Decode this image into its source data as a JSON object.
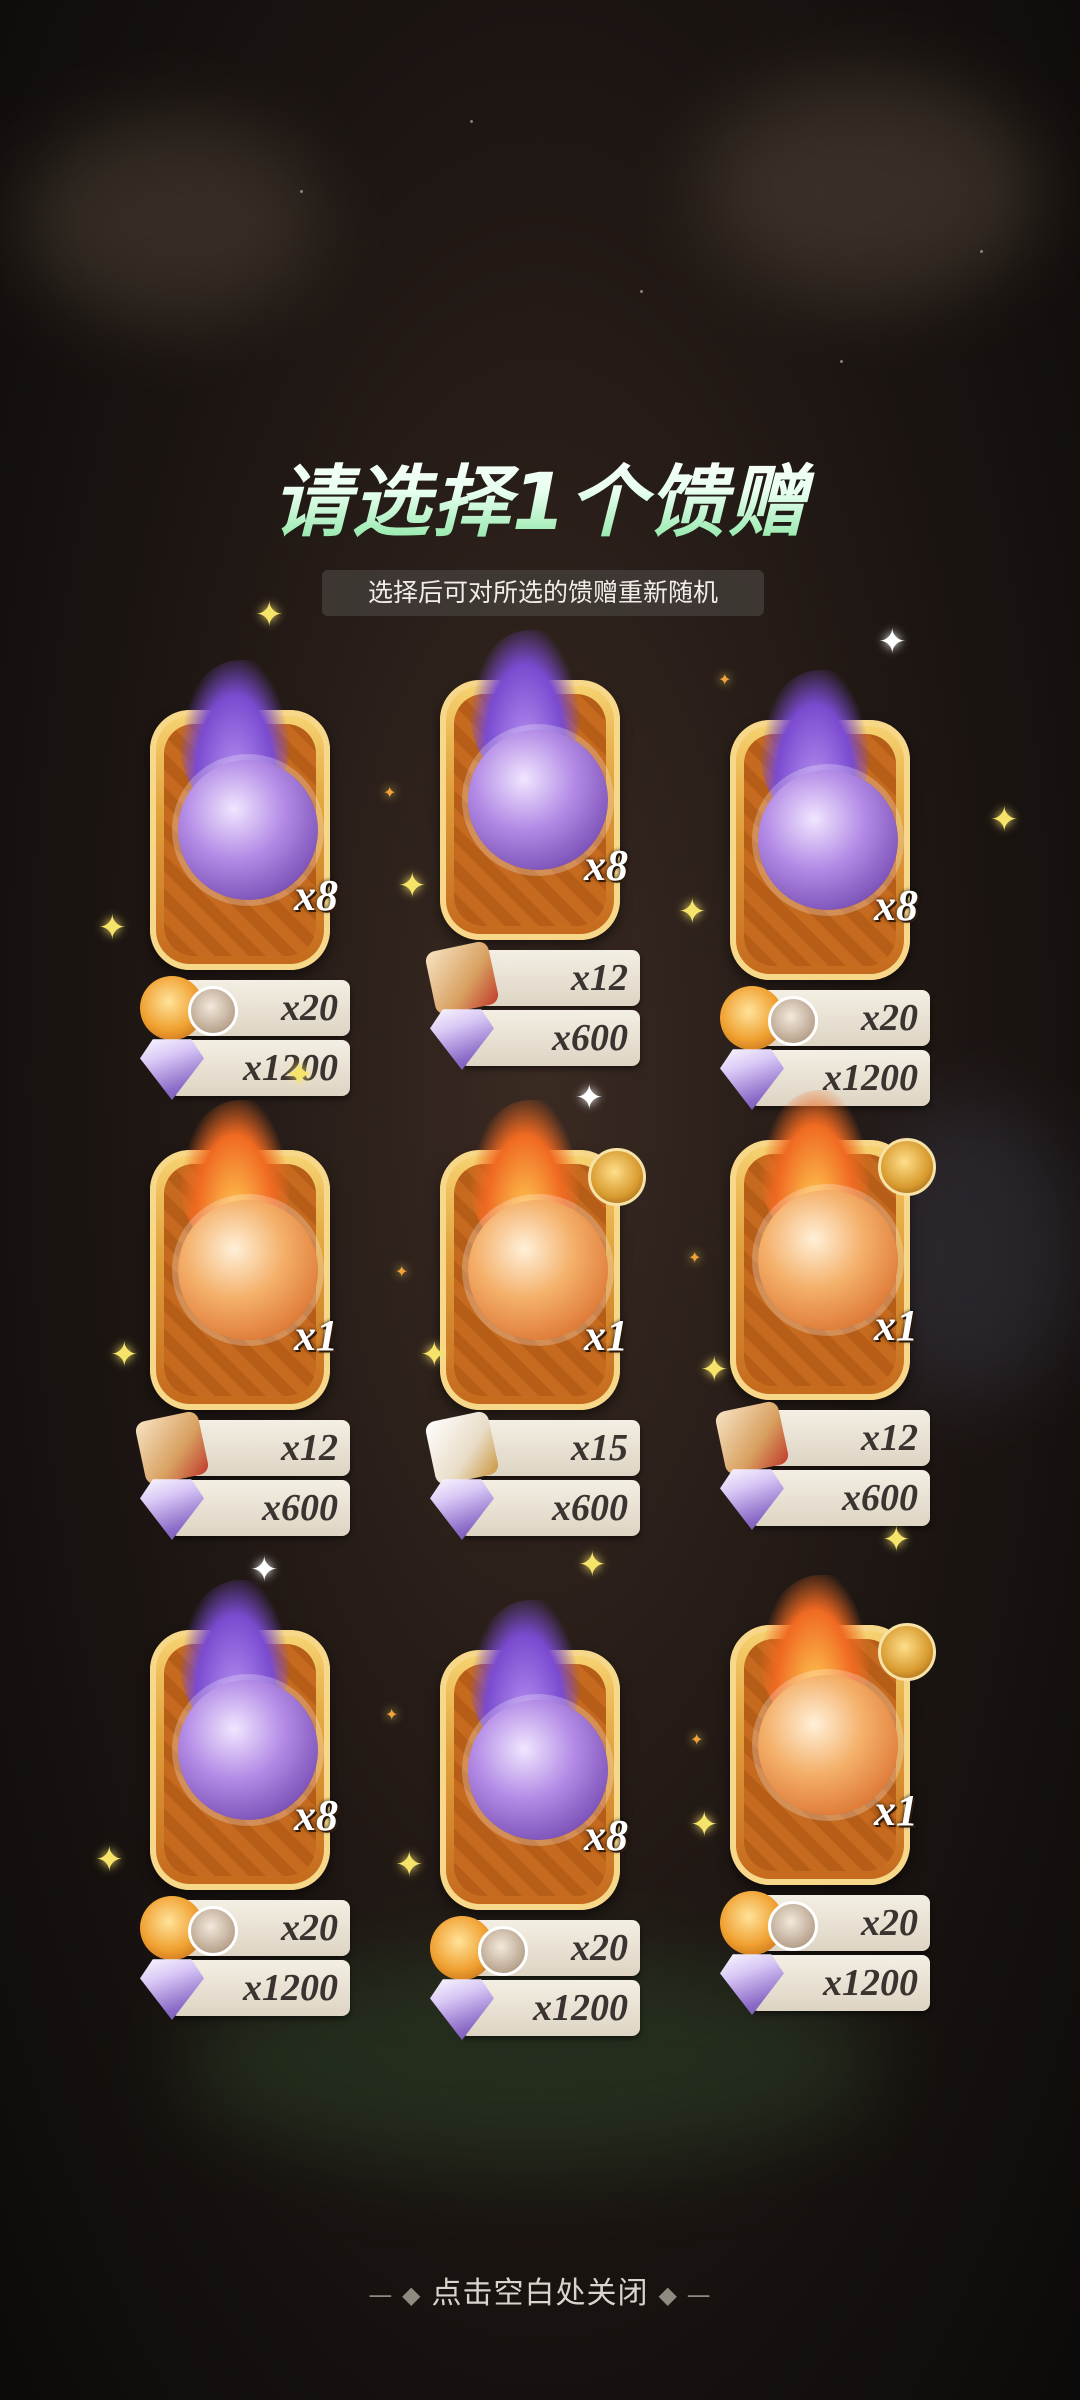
{
  "dialog": {
    "title": "请选择1个馈赠",
    "subtitle": "选择后可对所选的馈赠重新随机",
    "close_hint": "点击空白处关闭"
  },
  "cards": [
    {
      "flame": "purple",
      "character_multiplier": "x8",
      "reward1_icon": "gold-token-icon",
      "reward1_qty": "x20",
      "reward2_icon": "diamond-gem-icon",
      "reward2_qty": "x1200",
      "badge": false
    },
    {
      "flame": "purple",
      "character_multiplier": "x8",
      "reward1_icon": "red-envelope-icon",
      "reward1_qty": "x12",
      "reward2_icon": "diamond-gem-icon",
      "reward2_qty": "x600",
      "badge": false
    },
    {
      "flame": "purple",
      "character_multiplier": "x8",
      "reward1_icon": "gold-token-icon",
      "reward1_qty": "x20",
      "reward2_icon": "diamond-gem-icon",
      "reward2_qty": "x1200",
      "badge": false
    },
    {
      "flame": "fire",
      "character_multiplier": "x1",
      "reward1_icon": "red-envelope-icon",
      "reward1_qty": "x12",
      "reward2_icon": "diamond-gem-icon",
      "reward2_qty": "x600",
      "badge": false
    },
    {
      "flame": "fire",
      "character_multiplier": "x1",
      "reward1_icon": "white-envelope-icon",
      "reward1_qty": "x15",
      "reward2_icon": "diamond-gem-icon",
      "reward2_qty": "x600",
      "badge": true
    },
    {
      "flame": "fire",
      "character_multiplier": "x1",
      "reward1_icon": "red-envelope-icon",
      "reward1_qty": "x12",
      "reward2_icon": "diamond-gem-icon",
      "reward2_qty": "x600",
      "badge": true
    },
    {
      "flame": "purple",
      "character_multiplier": "x8",
      "reward1_icon": "gold-token-icon",
      "reward1_qty": "x20",
      "reward2_icon": "diamond-gem-icon",
      "reward2_qty": "x1200",
      "badge": false
    },
    {
      "flame": "purple",
      "character_multiplier": "x8",
      "reward1_icon": "gold-token-icon",
      "reward1_qty": "x20",
      "reward2_icon": "diamond-gem-icon",
      "reward2_qty": "x1200",
      "badge": false
    },
    {
      "flame": "fire",
      "character_multiplier": "x1",
      "reward1_icon": "gold-token-icon",
      "reward1_qty": "x20",
      "reward2_icon": "diamond-gem-icon",
      "reward2_qty": "x1200",
      "badge": true
    }
  ]
}
